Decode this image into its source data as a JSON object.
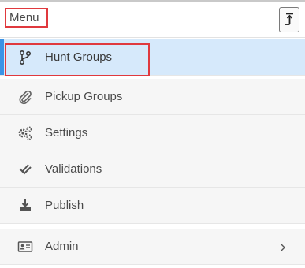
{
  "header": {
    "menu_label": "Menu",
    "collapse_icon": "collapse-up-icon"
  },
  "nav": {
    "items": [
      {
        "label": "Hunt Groups",
        "icon": "branch-icon",
        "active": true
      },
      {
        "label": "Pickup Groups",
        "icon": "paperclip-icon",
        "active": false
      },
      {
        "label": "Settings",
        "icon": "gears-icon",
        "active": false
      },
      {
        "label": "Validations",
        "icon": "double-check-icon",
        "active": false
      },
      {
        "label": "Publish",
        "icon": "download-tray-icon",
        "active": false
      },
      {
        "label": "Admin",
        "icon": "id-card-icon",
        "active": false,
        "has_submenu": true
      }
    ]
  },
  "colors": {
    "active_background": "#d6e9fb",
    "active_accent": "#3b93e6",
    "highlight_outline": "#e0393e",
    "item_background": "#f6f6f6"
  }
}
